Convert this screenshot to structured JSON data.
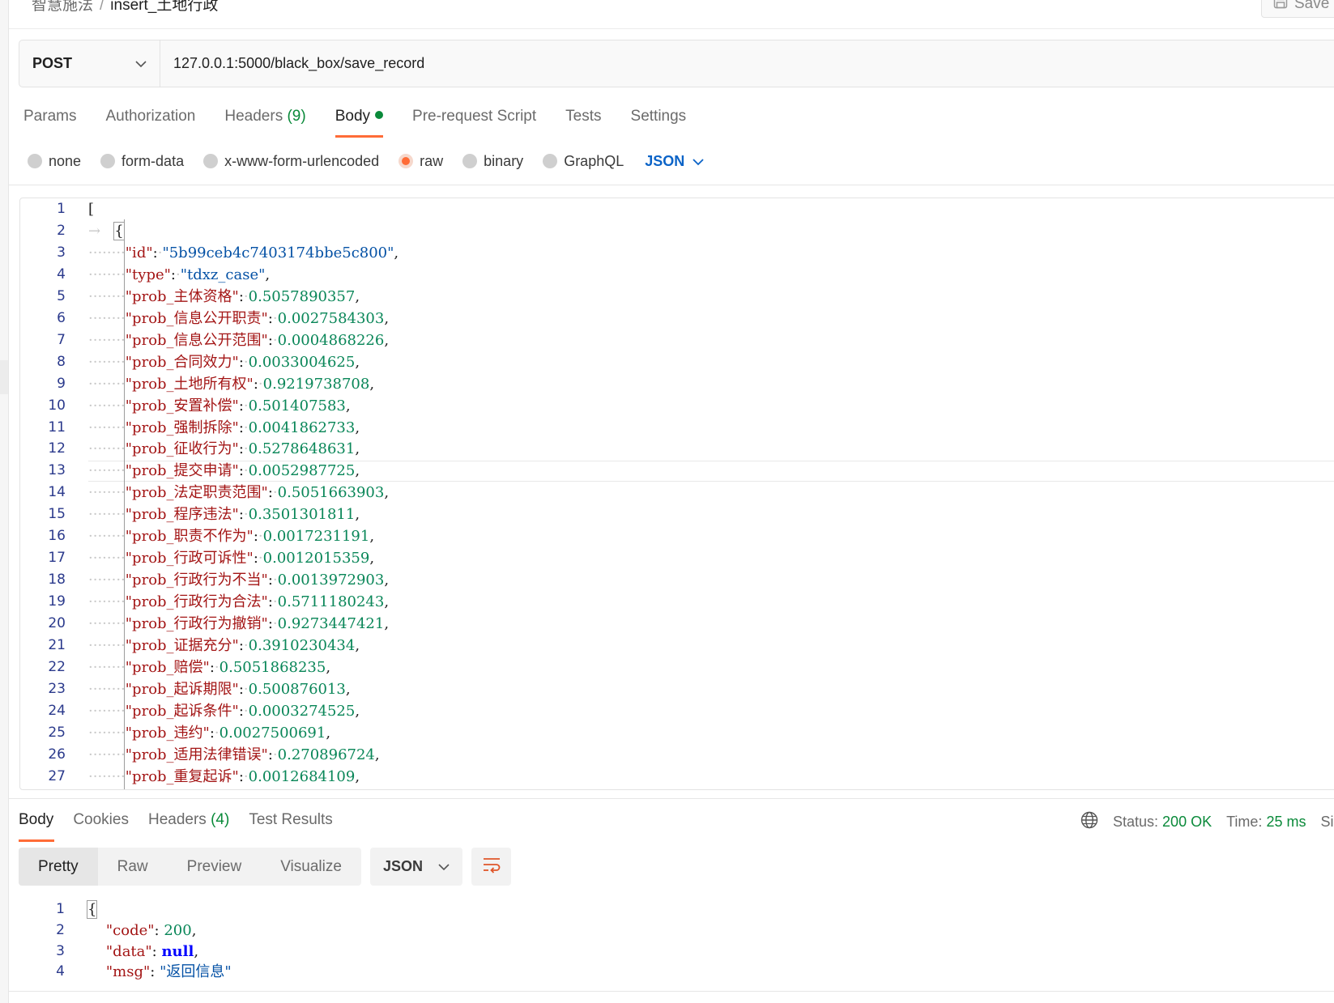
{
  "breadcrumb": {
    "parent": "智慧施法",
    "current": "insert_土地行政"
  },
  "save_label": "Save",
  "request": {
    "method": "POST",
    "url": "127.0.0.1:5000/black_box/save_record"
  },
  "request_tabs": [
    {
      "label": "Params"
    },
    {
      "label": "Authorization"
    },
    {
      "label": "Headers",
      "count": "(9)"
    },
    {
      "label": "Body",
      "active": true
    },
    {
      "label": "Pre-request Script"
    },
    {
      "label": "Tests"
    },
    {
      "label": "Settings"
    }
  ],
  "body_modes": [
    {
      "label": "none"
    },
    {
      "label": "form-data"
    },
    {
      "label": "x-www-form-urlencoded"
    },
    {
      "label": "raw",
      "selected": true
    },
    {
      "label": "binary"
    },
    {
      "label": "GraphQL"
    }
  ],
  "body_language": "JSON",
  "request_body": {
    "id": "5b99ceb4c7403174bbe5c800",
    "type": "tdxz_case",
    "probs": [
      [
        "prob_主体资格",
        "0.5057890357"
      ],
      [
        "prob_信息公开职责",
        "0.0027584303"
      ],
      [
        "prob_信息公开范围",
        "0.0004868226"
      ],
      [
        "prob_合同效力",
        "0.0033004625"
      ],
      [
        "prob_土地所有权",
        "0.9219738708"
      ],
      [
        "prob_安置补偿",
        "0.501407583"
      ],
      [
        "prob_强制拆除",
        "0.0041862733"
      ],
      [
        "prob_征收行为",
        "0.5278648631"
      ],
      [
        "prob_提交申请",
        "0.0052987725"
      ],
      [
        "prob_法定职责范围",
        "0.5051663903"
      ],
      [
        "prob_程序违法",
        "0.3501301811"
      ],
      [
        "prob_职责不作为",
        "0.0017231191"
      ],
      [
        "prob_行政可诉性",
        "0.0012015359"
      ],
      [
        "prob_行政行为不当",
        "0.0013972903"
      ],
      [
        "prob_行政行为合法",
        "0.5711180243"
      ],
      [
        "prob_行政行为撤销",
        "0.9273447421"
      ],
      [
        "prob_证据充分",
        "0.3910230434"
      ],
      [
        "prob_赔偿",
        "0.5051868235"
      ],
      [
        "prob_起诉期限",
        "0.500876013"
      ],
      [
        "prob_起诉条件",
        "0.0003274525"
      ],
      [
        "prob_违约",
        "0.0027500691"
      ],
      [
        "prob_适用法律错误",
        "0.270896724"
      ],
      [
        "prob_重复起诉",
        "0.0012684109"
      ]
    ]
  },
  "response_tabs": [
    {
      "label": "Body",
      "active": true
    },
    {
      "label": "Cookies"
    },
    {
      "label": "Headers",
      "count": "(4)"
    },
    {
      "label": "Test Results"
    }
  ],
  "response_status": {
    "status_label": "Status:",
    "status_value": "200 OK",
    "time_label": "Time:",
    "time_value": "25 ms",
    "size_label": "Siz"
  },
  "view_modes": [
    {
      "label": "Pretty",
      "active": true
    },
    {
      "label": "Raw"
    },
    {
      "label": "Preview"
    },
    {
      "label": "Visualize"
    }
  ],
  "response_format": "JSON",
  "response_body": {
    "code": "200",
    "data": "null",
    "msg": "返回信息"
  },
  "colors": {
    "accent": "#ff6c37",
    "success": "#0a8a3a",
    "link": "#0b63c7",
    "json_key": "#a31515",
    "json_string": "#0451a5",
    "json_number": "#098658"
  }
}
